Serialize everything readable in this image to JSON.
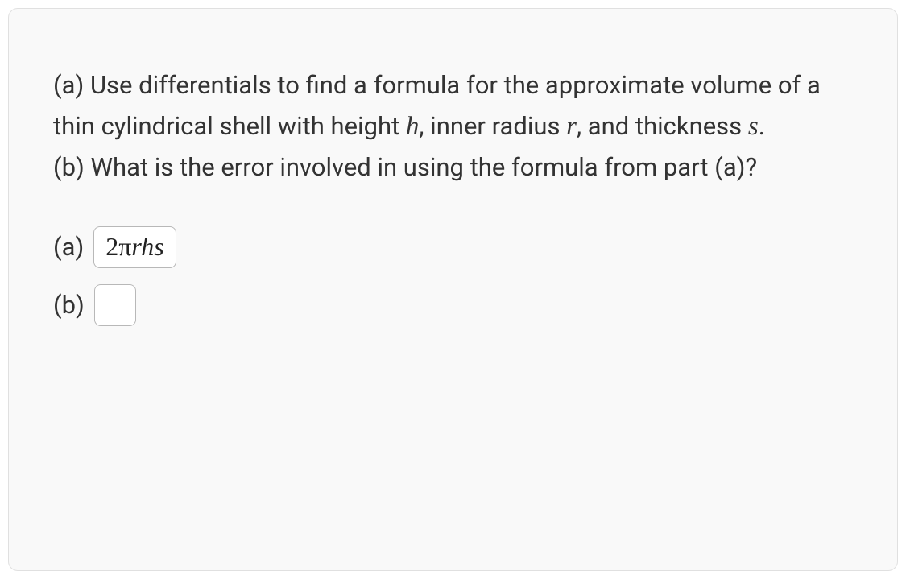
{
  "question": {
    "part_a_prefix": "(a) Use differentials to find a formula for the approximate volume of a thin cylindrical shell with height ",
    "var_h": "h",
    "mid1": ", inner radius ",
    "var_r": "r",
    "mid2": ", and thickness ",
    "var_s": "s",
    "period": ".",
    "part_b": "(b) What is the error involved in using the formula from part (a)?"
  },
  "answers": {
    "a_label": "(a)",
    "a_value_prefix": "2π",
    "a_value_ital": "rhs",
    "b_label": "(b)",
    "b_value": ""
  }
}
